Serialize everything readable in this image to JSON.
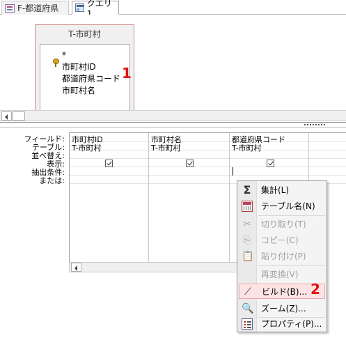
{
  "tabs": [
    {
      "label": "F-都道府県",
      "icon": "form-icon"
    },
    {
      "label": "クエリ1",
      "icon": "query-icon"
    }
  ],
  "table_box": {
    "title": "T-市町村",
    "fields": [
      "*",
      "市町村ID",
      "都道府県コード",
      "市町村名"
    ],
    "primary_key": "市町村ID"
  },
  "markers": {
    "one": "1",
    "two": "2"
  },
  "grid": {
    "row_labels": [
      "フィールド:",
      "テーブル:",
      "並べ替え:",
      "表示:",
      "抽出条件:",
      "または:"
    ],
    "columns": [
      {
        "field": "市町村ID",
        "table": "T-市町村",
        "show": true
      },
      {
        "field": "市町村名",
        "table": "T-市町村",
        "show": true
      },
      {
        "field": "都道府県コード",
        "table": "T-市町村",
        "show": true
      }
    ]
  },
  "context_menu": {
    "items": [
      {
        "label": "集計(L)",
        "icon": "sigma-icon",
        "enabled": true
      },
      {
        "label": "テーブル名(N)",
        "icon": "table-name-icon",
        "enabled": true
      },
      {
        "label": "切り取り(T)",
        "icon": "scissors-icon",
        "enabled": false
      },
      {
        "label": "コピー(C)",
        "icon": "copy-icon",
        "enabled": false
      },
      {
        "label": "貼り付け(P)",
        "icon": "paste-icon",
        "enabled": false
      },
      {
        "label": "再変換(V)",
        "icon": "",
        "enabled": false
      },
      {
        "label": "ビルド(B)...",
        "icon": "build-wand-icon",
        "enabled": true,
        "highlighted": true
      },
      {
        "label": "ズーム(Z)...",
        "icon": "zoom-icon",
        "enabled": true
      },
      {
        "label": "プロパティ(P)...",
        "icon": "properties-icon",
        "enabled": true
      }
    ]
  },
  "colors": {
    "marker": "#e21010",
    "highlight": "#fde4e4"
  }
}
